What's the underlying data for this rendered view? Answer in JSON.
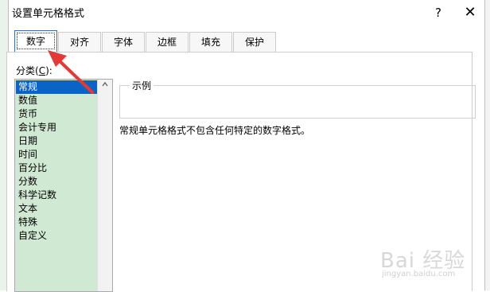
{
  "window": {
    "title": "设置单元格格式",
    "help_label": "?",
    "close_label": "✕"
  },
  "tabs": [
    {
      "label": "数字",
      "active": true
    },
    {
      "label": "对齐",
      "active": false
    },
    {
      "label": "字体",
      "active": false
    },
    {
      "label": "边框",
      "active": false
    },
    {
      "label": "填充",
      "active": false
    },
    {
      "label": "保护",
      "active": false
    }
  ],
  "category": {
    "label_prefix": "分类(",
    "label_key": "C",
    "label_suffix": "):",
    "items": [
      "常规",
      "数值",
      "货币",
      "会计专用",
      "日期",
      "时间",
      "百分比",
      "分数",
      "科学记数",
      "文本",
      "特殊",
      "自定义"
    ],
    "selected": "常规"
  },
  "example": {
    "label": "示例",
    "value": ""
  },
  "description": "常规单元格格式不包含任何特定的数字格式。",
  "watermark": {
    "text": "Bai 经验",
    "sub": "jingyan.baidu.com"
  },
  "colors": {
    "selected_bg": "#0a64c8",
    "list_bg": "#cfe9d2",
    "arrow": "#e53935"
  },
  "icons": {
    "scroll_up": "chevron-up-icon",
    "help": "help-icon",
    "close": "close-icon"
  }
}
